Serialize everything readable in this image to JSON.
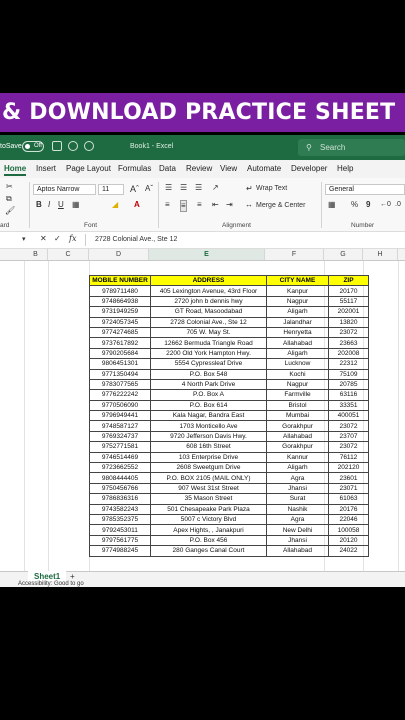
{
  "banner": {
    "text": "& DOWNLOAD PRACTICE SHEET"
  },
  "titlebar": {
    "autosave": "toSave",
    "toggle": "Off",
    "doc_title": "Book1 - Excel",
    "search_placeholder": "Search"
  },
  "menu": {
    "tabs": [
      "Home",
      "Insert",
      "Page Layout",
      "Formulas",
      "Data",
      "Review",
      "View",
      "Automate",
      "Developer",
      "Help"
    ]
  },
  "ribbon": {
    "font_name": "Aptos Narrow",
    "font_size": "11",
    "wrap_text": "Wrap Text",
    "merge_center": "Merge & Center",
    "number_format": "General",
    "percent": "%",
    "comma": "9",
    "group_font": "Font",
    "group_alignment": "Alignment",
    "group_number": "Number",
    "group_clipboard": "ard"
  },
  "formula_bar": {
    "fx": "fx",
    "content": "2728 Colonial Ave., Ste 12"
  },
  "columns": [
    "B",
    "C",
    "D",
    "E",
    "F",
    "G",
    "H"
  ],
  "table": {
    "headers": [
      "MOBILE NUMBER",
      "ADDRESS",
      "CITY NAME",
      "ZIP"
    ],
    "rows": [
      [
        "9789711480",
        "405 Lexington Avenue, 43rd Floor",
        "Kanpur",
        "20170"
      ],
      [
        "9748664938",
        "2720 john b dennis hwy",
        "Nagpur",
        "55117"
      ],
      [
        "9731949259",
        "GT Road, Masoodabad",
        "Aligarh",
        "202001"
      ],
      [
        "9724057345",
        "2728 Colonial Ave., Ste 12",
        "Jalandhar",
        "13820"
      ],
      [
        "9774274685",
        "705 W. May St.",
        "Henryetta",
        "23072"
      ],
      [
        "9737617892",
        "12662 Bermuda Triangle Road",
        "Allahabad",
        "23663"
      ],
      [
        "9790205684",
        "2200 Old York Hampton Hwy.",
        "Aligarh",
        "202008"
      ],
      [
        "9806451301",
        "5554 Cypressleaf Drive",
        "Lucknow",
        "22312"
      ],
      [
        "9771350494",
        "P.O. Box 548",
        "Kochi",
        "75109"
      ],
      [
        "9783077565",
        "4 North Park Drive",
        "Nagpur",
        "20785"
      ],
      [
        "9776222242",
        "P.O. Box A",
        "Farmville",
        "63116"
      ],
      [
        "9770506090",
        "P.O. Box 614",
        "Bristol",
        "33351"
      ],
      [
        "9796949441",
        "Kala Nagar, Bandra East",
        "Mumbai",
        "400051"
      ],
      [
        "9748587127",
        "1703 Monticello Ave",
        "Gorakhpur",
        "23072"
      ],
      [
        "9769324737",
        "9720 Jefferson Davis Hwy.",
        "Allahabad",
        "23707"
      ],
      [
        "9752771581",
        "608 16th Street",
        "Gorakhpur",
        "23072"
      ],
      [
        "9746514469",
        "103 Enterprise Drive",
        "Kannur",
        "76112"
      ],
      [
        "9723662552",
        "2608 Sweetgum Drive",
        "Aligarh",
        "202120"
      ],
      [
        "9808444405",
        "P.O. BOX 2105 (MAIL ONLY)",
        "Agra",
        "23601"
      ],
      [
        "9750456766",
        "907 West 31st Street",
        "Jhansi",
        "23071"
      ],
      [
        "9786836316",
        "35 Mason Street",
        "Surat",
        "61063"
      ],
      [
        "9743582243",
        "501 Chesapeake Park Plaza",
        "Nashik",
        "20176"
      ],
      [
        "9785352375",
        "5007 c Victory Blvd",
        "Agra",
        "22046"
      ],
      [
        "9792453011",
        "Apex Hights, , Janakpuri",
        "New Delhi",
        "100058"
      ],
      [
        "9797561775",
        "P.O. Box 456",
        "Jhansi",
        "20120"
      ],
      [
        "9774988245",
        "280 Ganges Canal Court",
        "Allahabad",
        "24022"
      ]
    ]
  },
  "sheet_tab": "Sheet1",
  "status": "Accessibility: Good to go"
}
